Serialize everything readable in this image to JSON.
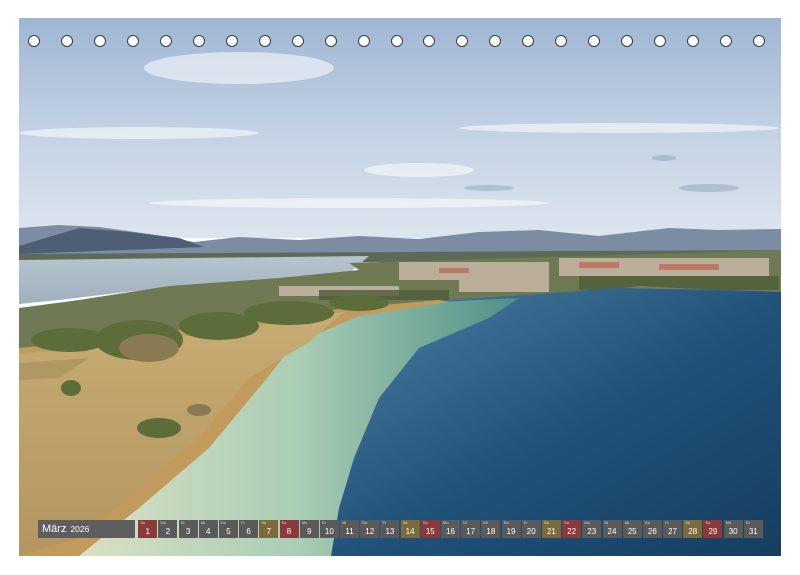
{
  "calendar": {
    "month": "März",
    "year": "2026",
    "days": [
      {
        "n": "1",
        "w": "So",
        "type": "sun"
      },
      {
        "n": "2",
        "w": "Mo",
        "type": "wd"
      },
      {
        "n": "3",
        "w": "Di",
        "type": "wd"
      },
      {
        "n": "4",
        "w": "Mi",
        "type": "wd"
      },
      {
        "n": "5",
        "w": "Do",
        "type": "wd"
      },
      {
        "n": "6",
        "w": "Fr",
        "type": "wd"
      },
      {
        "n": "7",
        "w": "Sa",
        "type": "sat"
      },
      {
        "n": "8",
        "w": "So",
        "type": "sun"
      },
      {
        "n": "9",
        "w": "Mo",
        "type": "wd"
      },
      {
        "n": "10",
        "w": "Di",
        "type": "wd"
      },
      {
        "n": "11",
        "w": "Mi",
        "type": "wd"
      },
      {
        "n": "12",
        "w": "Do",
        "type": "wd"
      },
      {
        "n": "13",
        "w": "Fr",
        "type": "wd"
      },
      {
        "n": "14",
        "w": "Sa",
        "type": "sat"
      },
      {
        "n": "15",
        "w": "So",
        "type": "sun"
      },
      {
        "n": "16",
        "w": "Mo",
        "type": "wd"
      },
      {
        "n": "17",
        "w": "Di",
        "type": "wd"
      },
      {
        "n": "18",
        "w": "Mi",
        "type": "wd"
      },
      {
        "n": "19",
        "w": "Do",
        "type": "wd"
      },
      {
        "n": "20",
        "w": "Fr",
        "type": "wd"
      },
      {
        "n": "21",
        "w": "Sa",
        "type": "sat"
      },
      {
        "n": "22",
        "w": "So",
        "type": "sun"
      },
      {
        "n": "23",
        "w": "Mo",
        "type": "wd"
      },
      {
        "n": "24",
        "w": "Di",
        "type": "wd"
      },
      {
        "n": "25",
        "w": "Mi",
        "type": "wd"
      },
      {
        "n": "26",
        "w": "Do",
        "type": "wd"
      },
      {
        "n": "27",
        "w": "Fr",
        "type": "wd"
      },
      {
        "n": "28",
        "w": "Sa",
        "type": "sat"
      },
      {
        "n": "29",
        "w": "So",
        "type": "sun"
      },
      {
        "n": "30",
        "w": "Mo",
        "type": "wd"
      },
      {
        "n": "31",
        "w": "Di",
        "type": "wd"
      }
    ]
  },
  "binding": {
    "hole_count": 23
  },
  "colors": {
    "weekday": "#5a5a5a",
    "saturday": "#7d6a3a",
    "sunday": "#8b3a3a",
    "month_bg": "#5e5e5e"
  }
}
